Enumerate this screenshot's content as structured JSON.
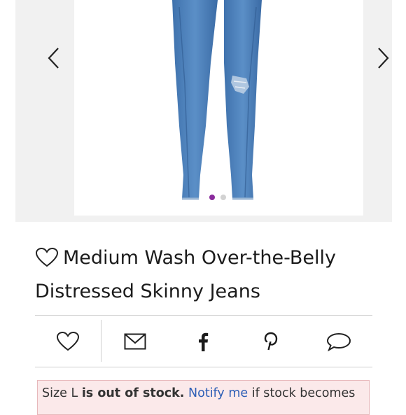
{
  "gallery": {
    "prev_icon": "chevron-left-icon",
    "next_icon": "chevron-right-icon",
    "image_count": 2,
    "active_index": 0,
    "dot_active_color": "#8a2b9c",
    "dot_inactive_color": "#d2d2d2"
  },
  "product": {
    "title": "Medium Wash Over-the-Belly Distressed Skinny Jeans",
    "like_icon": "heart-outline-icon"
  },
  "share_bar": {
    "items": [
      {
        "name": "like",
        "icon": "heart-outline-icon"
      },
      {
        "name": "email",
        "icon": "envelope-icon"
      },
      {
        "name": "facebook",
        "icon": "facebook-icon"
      },
      {
        "name": "pinterest",
        "icon": "pinterest-icon"
      },
      {
        "name": "comment",
        "icon": "speech-bubble-icon"
      }
    ]
  },
  "stock_alert": {
    "prefix": "Size L ",
    "bold_text": "is out of stock.",
    "link_text": "Notify me",
    "suffix": " if stock becomes",
    "background": "#fbe9ea",
    "link_color": "#2e5fb6"
  }
}
